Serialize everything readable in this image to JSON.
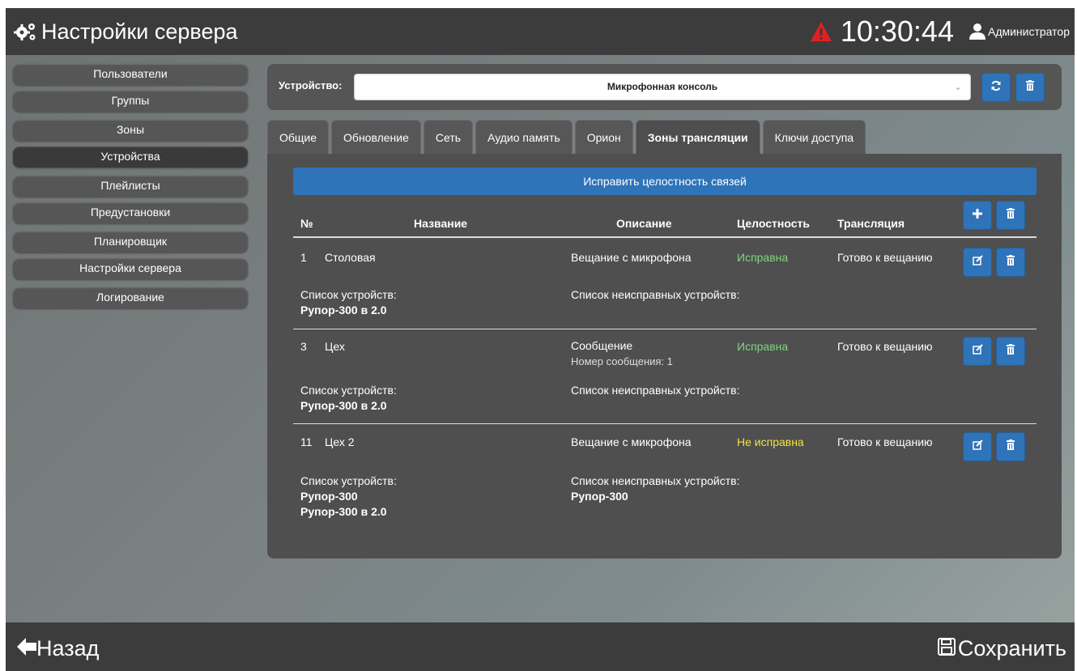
{
  "header": {
    "title": "Настройки сервера",
    "time": "10:30:44",
    "user": "Администратор",
    "warning_color": "#e02020"
  },
  "sidebar": {
    "items": [
      {
        "label": "Пользователи"
      },
      {
        "label": "Группы"
      },
      {
        "label": "Зоны"
      },
      {
        "label": "Устройства",
        "active": true
      },
      {
        "label": "Плейлисты"
      },
      {
        "label": "Предустановки"
      },
      {
        "label": "Планировщик"
      },
      {
        "label": "Настройки сервера"
      },
      {
        "label": "Логирование"
      }
    ]
  },
  "device": {
    "label": "Устройство:",
    "selected": "Микрофонная консоль"
  },
  "tabs": [
    {
      "label": "Общие"
    },
    {
      "label": "Обновление"
    },
    {
      "label": "Сеть"
    },
    {
      "label": "Аудио память"
    },
    {
      "label": "Орион"
    },
    {
      "label": "Зоны трансляции",
      "active": true
    },
    {
      "label": "Ключи доступа"
    }
  ],
  "panel": {
    "fix_button": "Исправить целостность связей",
    "columns": {
      "num": "№",
      "name": "Название",
      "desc": "Описание",
      "integrity": "Целостность",
      "broadcast": "Трансляция"
    },
    "rows": [
      {
        "num": "1",
        "name": "Столовая",
        "desc1": "Вещание с микрофона",
        "desc2": "",
        "integrity": "Исправна",
        "broadcast": "Готово к вещанию",
        "devices_label": "Список устройств:",
        "devices": [
          "Рупор-300 в 2.0"
        ],
        "faulty_label": "Список неисправных устройств:",
        "faulty": []
      },
      {
        "num": "3",
        "name": "Цех",
        "desc1": "Сообщение",
        "desc2": "Номер сообщения: 1",
        "integrity": "Исправна",
        "broadcast": "Готово к вещанию",
        "devices_label": "Список устройств:",
        "devices": [
          "Рупор-300 в 2.0"
        ],
        "faulty_label": "Список неисправных устройств:",
        "faulty": []
      },
      {
        "num": "11",
        "name": "Цех 2",
        "desc1": "Вещание с микрофона",
        "desc2": "",
        "integrity": "Не исправна",
        "broadcast": "Готово к вещанию",
        "devices_label": "Список устройств:",
        "devices": [
          "Рупор-300",
          "Рупор-300 в 2.0"
        ],
        "faulty_label": "Список неисправных устройств:",
        "faulty": [
          "Рупор-300"
        ]
      }
    ]
  },
  "footer": {
    "back": "Назад",
    "save": "Сохранить"
  },
  "colors": {
    "accent": "#2f73b8",
    "ok": "#7fd67f",
    "bad": "#f1e33d"
  }
}
